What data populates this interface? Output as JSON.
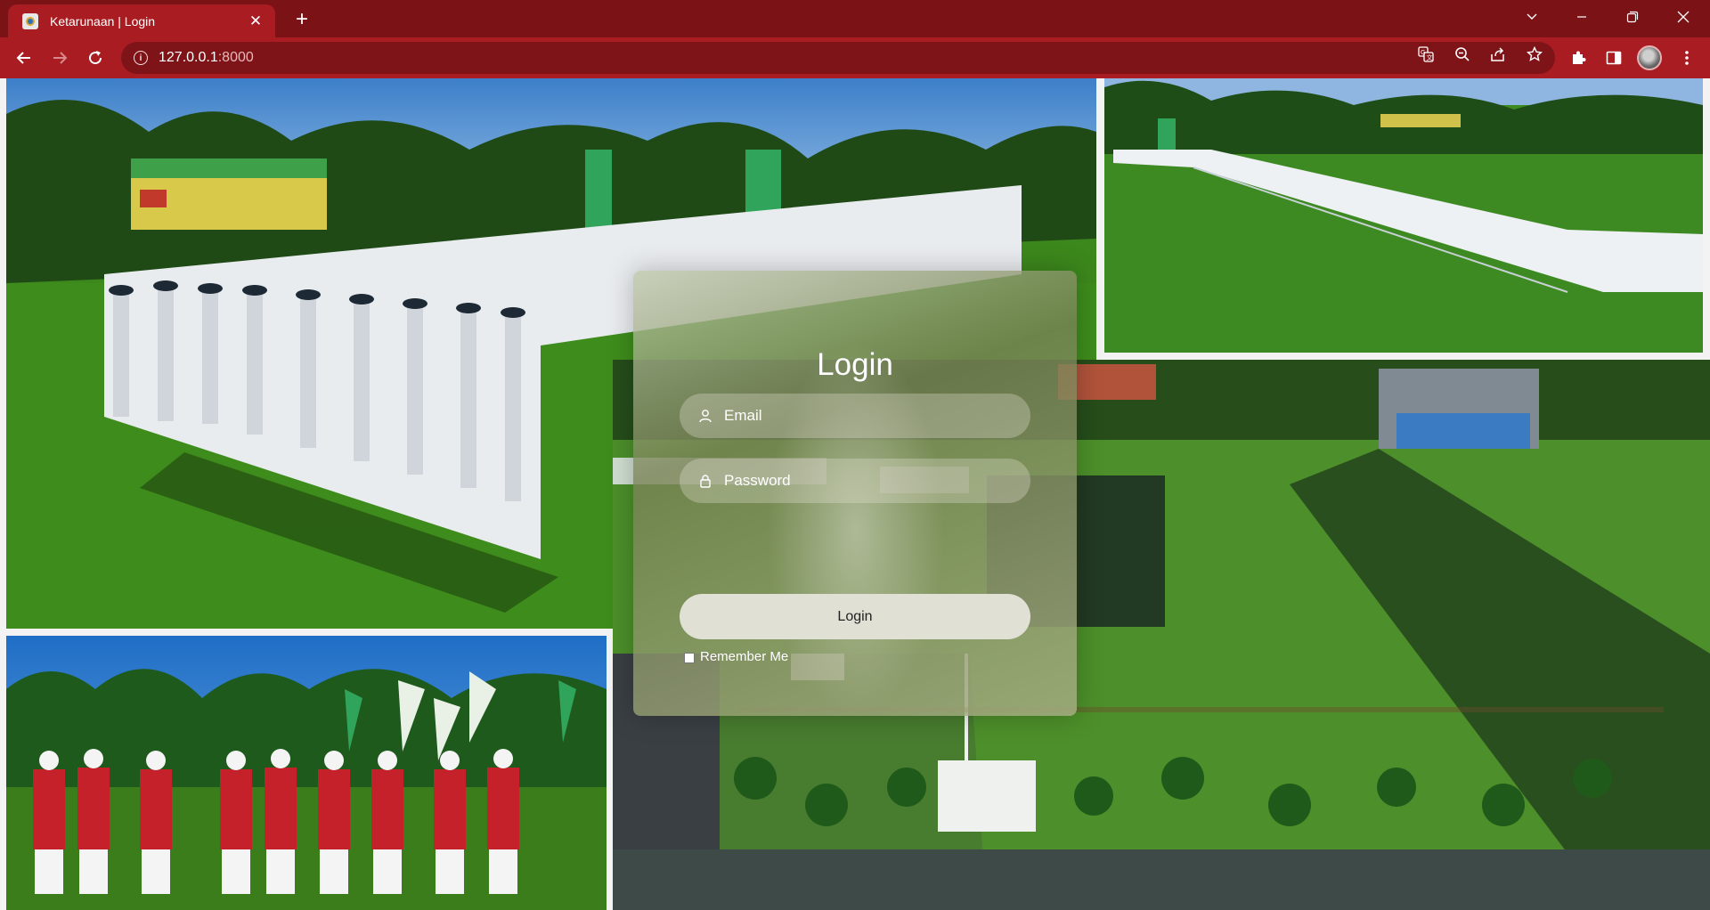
{
  "browser": {
    "tab": {
      "title": "Ketarunaan | Login"
    },
    "address_bar": {
      "host": "127.0.0.1",
      "port": ":8000"
    }
  },
  "login": {
    "title": "Login",
    "email_placeholder": "Email",
    "password_placeholder": "Password",
    "submit_label": "Login",
    "remember_label": "Remember Me"
  },
  "colors": {
    "chrome_dark": "#7a1216",
    "chrome_accent": "#a81c22",
    "omnibox": "#7e1418",
    "button_bg": "#e0e0d4"
  },
  "icons": [
    "favicon",
    "close-icon",
    "plus-icon",
    "chevron-down-icon",
    "minimize-icon",
    "restore-icon",
    "close-window-icon",
    "back-arrow-icon",
    "forward-arrow-icon",
    "reload-icon",
    "info-icon",
    "translate-icon",
    "zoom-out-icon",
    "share-icon",
    "star-icon",
    "puzzle-icon",
    "side-panel-icon",
    "profile-avatar",
    "menu-dots-icon",
    "user-icon",
    "lock-icon"
  ]
}
